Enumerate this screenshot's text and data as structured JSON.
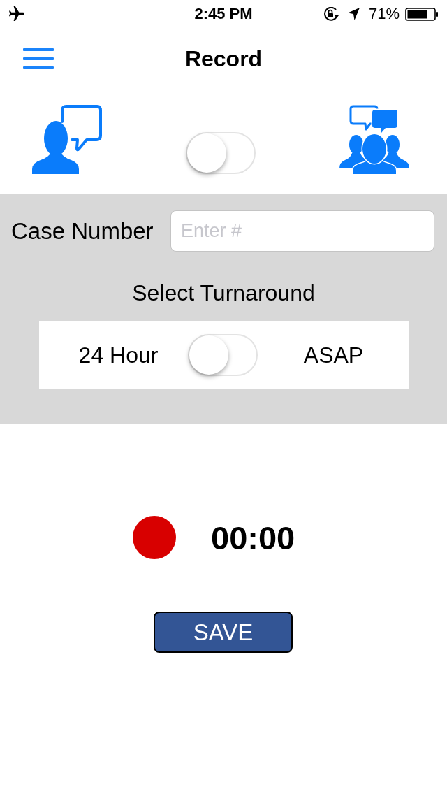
{
  "status_bar": {
    "time": "2:45 PM",
    "battery": "71%"
  },
  "nav": {
    "title": "Record"
  },
  "mode_switch": {
    "on": false
  },
  "case_number": {
    "label": "Case Number",
    "placeholder": "Enter #"
  },
  "turnaround": {
    "title": "Select Turnaround",
    "left_label": "24 Hour",
    "right_label": "ASAP",
    "on": false
  },
  "recorder": {
    "time": "00:00"
  },
  "save_button": {
    "label": "SAVE"
  }
}
